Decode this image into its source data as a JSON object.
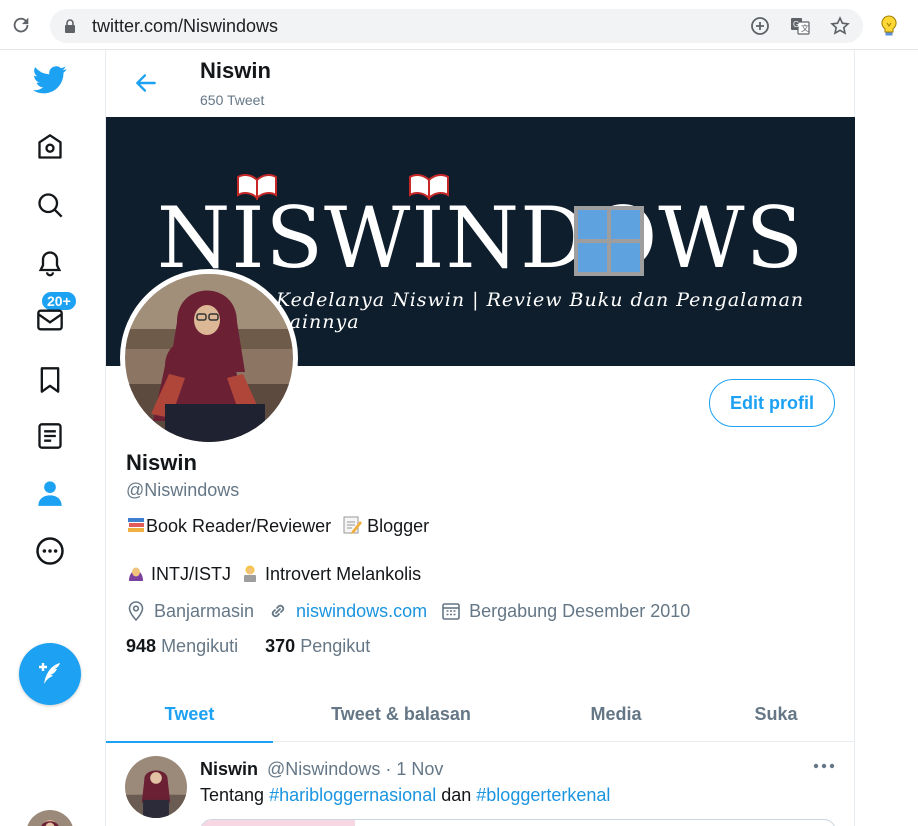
{
  "browser": {
    "url": "twitter.com/Niswindows"
  },
  "colors": {
    "accent": "#1da1f2",
    "link": "#1b95e0",
    "banner_bg": "#0e1e2c"
  },
  "nav": {
    "items": [
      {
        "icon": "twitter-logo-icon"
      },
      {
        "icon": "home-icon"
      },
      {
        "icon": "search-icon"
      },
      {
        "icon": "bell-icon"
      },
      {
        "icon": "mail-icon"
      },
      {
        "icon": "bookmark-icon"
      },
      {
        "icon": "list-icon"
      },
      {
        "icon": "profile-icon"
      },
      {
        "icon": "more-icon"
      }
    ],
    "notification_badge": "20+"
  },
  "header": {
    "name": "Niswin",
    "tweet_count": "650 Tweet"
  },
  "banner": {
    "title": "NISWINDOWS",
    "subtitle": "Kedelanya Niswin | Review Buku dan Pengalaman Lainnya"
  },
  "profile": {
    "edit_label": "Edit profil",
    "name": "Niswin",
    "handle": "@Niswindows",
    "bio_line1_a": "Book Reader/Reviewer",
    "bio_line1_b": "Blogger",
    "bio_line2_a": "INTJ/ISTJ",
    "bio_line2_b": "Introvert Melankolis",
    "location": "Banjarmasin",
    "website": "niswindows.com",
    "joined": "Bergabung Desember 2010",
    "following_count": "948",
    "following_label": "Mengikuti",
    "followers_count": "370",
    "followers_label": "Pengikut"
  },
  "tabs": [
    {
      "label": "Tweet",
      "active": true
    },
    {
      "label": "Tweet & balasan",
      "active": false
    },
    {
      "label": "Media",
      "active": false
    },
    {
      "label": "Suka",
      "active": false
    }
  ],
  "tweet": {
    "name": "Niswin",
    "handle": "@Niswindows",
    "sep": "·",
    "date": "1 Nov",
    "text_a": "Tentang",
    "hashtag1": "#haribloggernasional",
    "text_b": "dan",
    "hashtag2": "#bloggerterkenal"
  }
}
